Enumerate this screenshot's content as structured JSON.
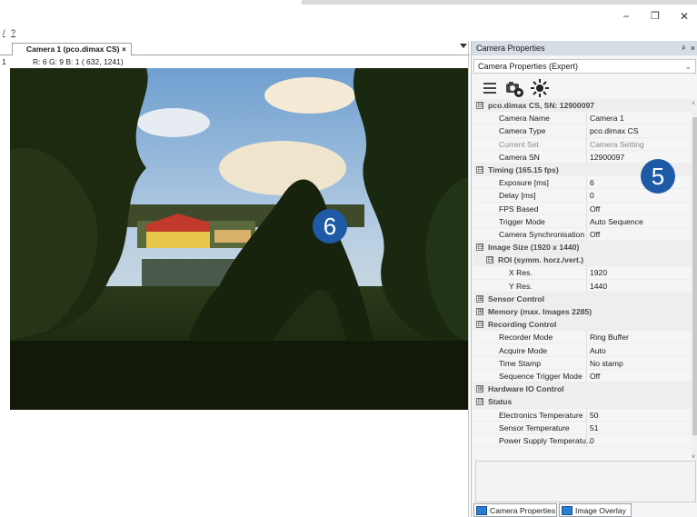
{
  "window": {
    "minimize_glyph": "−",
    "restore_glyph": "❐",
    "close_glyph": "✕"
  },
  "menu": [
    "/",
    "?"
  ],
  "document": {
    "tab_label": "Camera 1 (pco.dimax CS)",
    "tab_close": "×",
    "line_number": "1",
    "pixel_info": "R:   6 G:   9 B:   1 ( 632, 1241)"
  },
  "callouts": {
    "image_area": "6",
    "properties_panel": "5"
  },
  "panel": {
    "title": "Camera Properties",
    "pin_glyph": "ᵖ",
    "close_glyph": "×",
    "selector_value": "Camera Properties (Expert)",
    "toolbar_icons": [
      "list-icon",
      "camera-settings-icon",
      "sun-icon"
    ]
  },
  "property_grid": [
    {
      "type": "cat",
      "indent": 0,
      "expander": "⊟",
      "name": "pco.dimax CS, SN: 12900097"
    },
    {
      "type": "prop",
      "indent": 1,
      "name": "Camera Name",
      "value": "Camera 1"
    },
    {
      "type": "prop",
      "indent": 1,
      "name": "Camera Type",
      "value": "pco.dimax CS"
    },
    {
      "type": "prop",
      "indent": 1,
      "name": "Current Set",
      "value": "Camera Setting",
      "dim": true
    },
    {
      "type": "prop",
      "indent": 1,
      "name": "Camera SN",
      "value": "12900097"
    },
    {
      "type": "cat",
      "indent": 0,
      "expander": "⊟",
      "name": "Timing (165.15 fps)"
    },
    {
      "type": "prop",
      "indent": 1,
      "name": "Exposure [ms]",
      "value": "6"
    },
    {
      "type": "prop",
      "indent": 1,
      "name": "Delay [ms]",
      "value": "0"
    },
    {
      "type": "prop",
      "indent": 1,
      "name": "FPS Based",
      "value": "Off"
    },
    {
      "type": "prop",
      "indent": 1,
      "name": "Trigger Mode",
      "value": "Auto Sequence"
    },
    {
      "type": "prop",
      "indent": 1,
      "name": "Camera Synchronisation",
      "value": "Off"
    },
    {
      "type": "cat",
      "indent": 0,
      "expander": "⊟",
      "name": "Image Size (1920 x 1440)"
    },
    {
      "type": "cat",
      "indent": 1,
      "expander": "⊟",
      "name": "ROI (symm. horz./vert.)"
    },
    {
      "type": "prop",
      "indent": 2,
      "name": "X Res.",
      "value": "1920"
    },
    {
      "type": "prop",
      "indent": 2,
      "name": "Y Res.",
      "value": "1440"
    },
    {
      "type": "cat",
      "indent": 0,
      "expander": "⊞",
      "name": "Sensor Control"
    },
    {
      "type": "cat",
      "indent": 0,
      "expander": "⊞",
      "name": "Memory (max. Images 2285)"
    },
    {
      "type": "cat",
      "indent": 0,
      "expander": "⊟",
      "name": "Recording Control"
    },
    {
      "type": "prop",
      "indent": 1,
      "name": "Recorder Mode",
      "value": "Ring Buffer"
    },
    {
      "type": "prop",
      "indent": 1,
      "name": "Acquire Mode",
      "value": "Auto"
    },
    {
      "type": "prop",
      "indent": 1,
      "name": "Time Stamp",
      "value": "No stamp"
    },
    {
      "type": "prop",
      "indent": 1,
      "name": "Sequence Trigger Mode",
      "value": "Off"
    },
    {
      "type": "cat",
      "indent": 0,
      "expander": "⊞",
      "name": "Hardware IO Control"
    },
    {
      "type": "cat",
      "indent": 0,
      "expander": "⊟",
      "name": "Status"
    },
    {
      "type": "prop",
      "indent": 1,
      "name": "Electronics Temperature",
      "value": "50"
    },
    {
      "type": "prop",
      "indent": 1,
      "name": "Sensor Temperature",
      "value": "51"
    },
    {
      "type": "prop",
      "indent": 1,
      "name": "Power Supply Temperatu...",
      "value": "0"
    }
  ],
  "bottom_tabs": [
    {
      "label": "Camera Properties"
    },
    {
      "label": "Image Overlay"
    }
  ]
}
